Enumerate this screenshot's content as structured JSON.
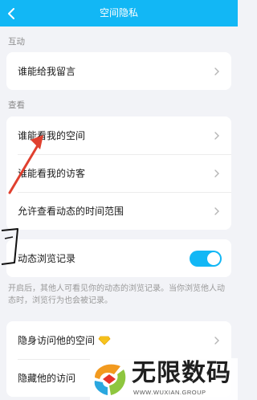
{
  "header": {
    "title": "空间隐私"
  },
  "sections": [
    {
      "label": "互动"
    },
    {
      "label": "查看"
    }
  ],
  "interaction": {
    "items": [
      {
        "label": "谁能给我留言"
      }
    ]
  },
  "viewing": {
    "items": [
      {
        "label": "谁能看我的空间"
      },
      {
        "label": "谁能看我的访客"
      },
      {
        "label": "允许查看动态的时间范围"
      }
    ]
  },
  "browse_record": {
    "label": "动态浏览记录",
    "enabled": true,
    "description": "开启后，其他人可看见你的动态的浏览记录。当你浏览他人动态时，浏览行为也会被记录。"
  },
  "stealth": {
    "items": [
      {
        "label": "隐身访问他的空间",
        "icon": "diamond-icon"
      },
      {
        "label": "隐藏他的访问"
      }
    ]
  },
  "watermark": {
    "main": "无限数码",
    "sub": "WWW.WUXIAN.GROUP"
  },
  "colors": {
    "accent": "#12b7f5",
    "annotation": "#e0402f"
  }
}
